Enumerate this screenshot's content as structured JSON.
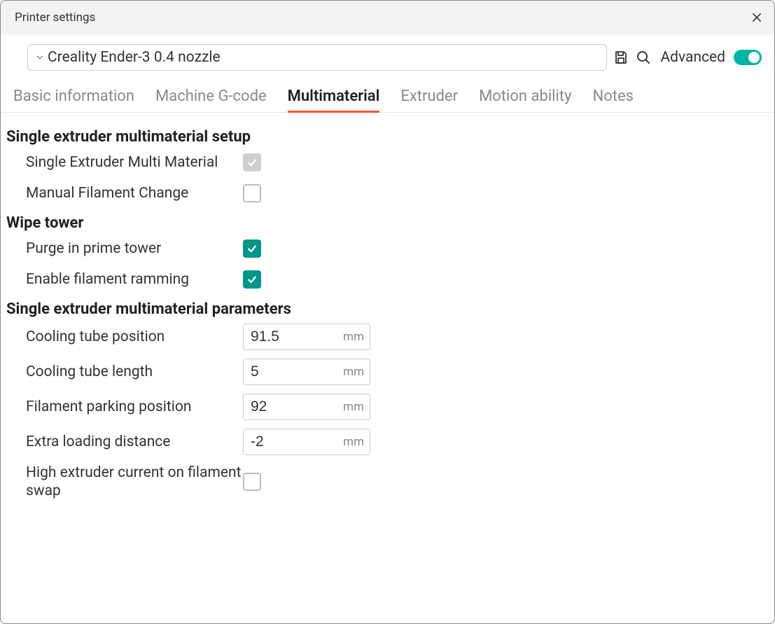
{
  "window": {
    "title": "Printer settings"
  },
  "profile": {
    "name": "Creality Ender-3 0.4 nozzle",
    "advanced_label": "Advanced",
    "advanced_on": true
  },
  "tabs": {
    "basic": "Basic information",
    "gcode": "Machine G-code",
    "multimaterial": "Multimaterial",
    "extruder": "Extruder",
    "motion": "Motion ability",
    "notes": "Notes"
  },
  "sections": {
    "setup": {
      "heading": "Single extruder multimaterial setup",
      "semm": {
        "label": "Single Extruder Multi Material",
        "checked": true,
        "locked": true
      },
      "manual": {
        "label": "Manual Filament Change",
        "checked": false
      }
    },
    "wipe": {
      "heading": "Wipe tower",
      "purge": {
        "label": "Purge in prime tower",
        "checked": true
      },
      "ramming": {
        "label": "Enable filament ramming",
        "checked": true
      }
    },
    "params": {
      "heading": "Single extruder multimaterial parameters",
      "cooling_pos": {
        "label": "Cooling tube position",
        "value": "91.5",
        "unit": "mm"
      },
      "cooling_len": {
        "label": "Cooling tube length",
        "value": "5",
        "unit": "mm"
      },
      "parking": {
        "label": "Filament parking position",
        "value": "92",
        "unit": "mm"
      },
      "extra_loading": {
        "label": "Extra loading distance",
        "value": "-2",
        "unit": "mm"
      },
      "high_current": {
        "label": "High extruder current on filament swap",
        "checked": false
      }
    }
  }
}
